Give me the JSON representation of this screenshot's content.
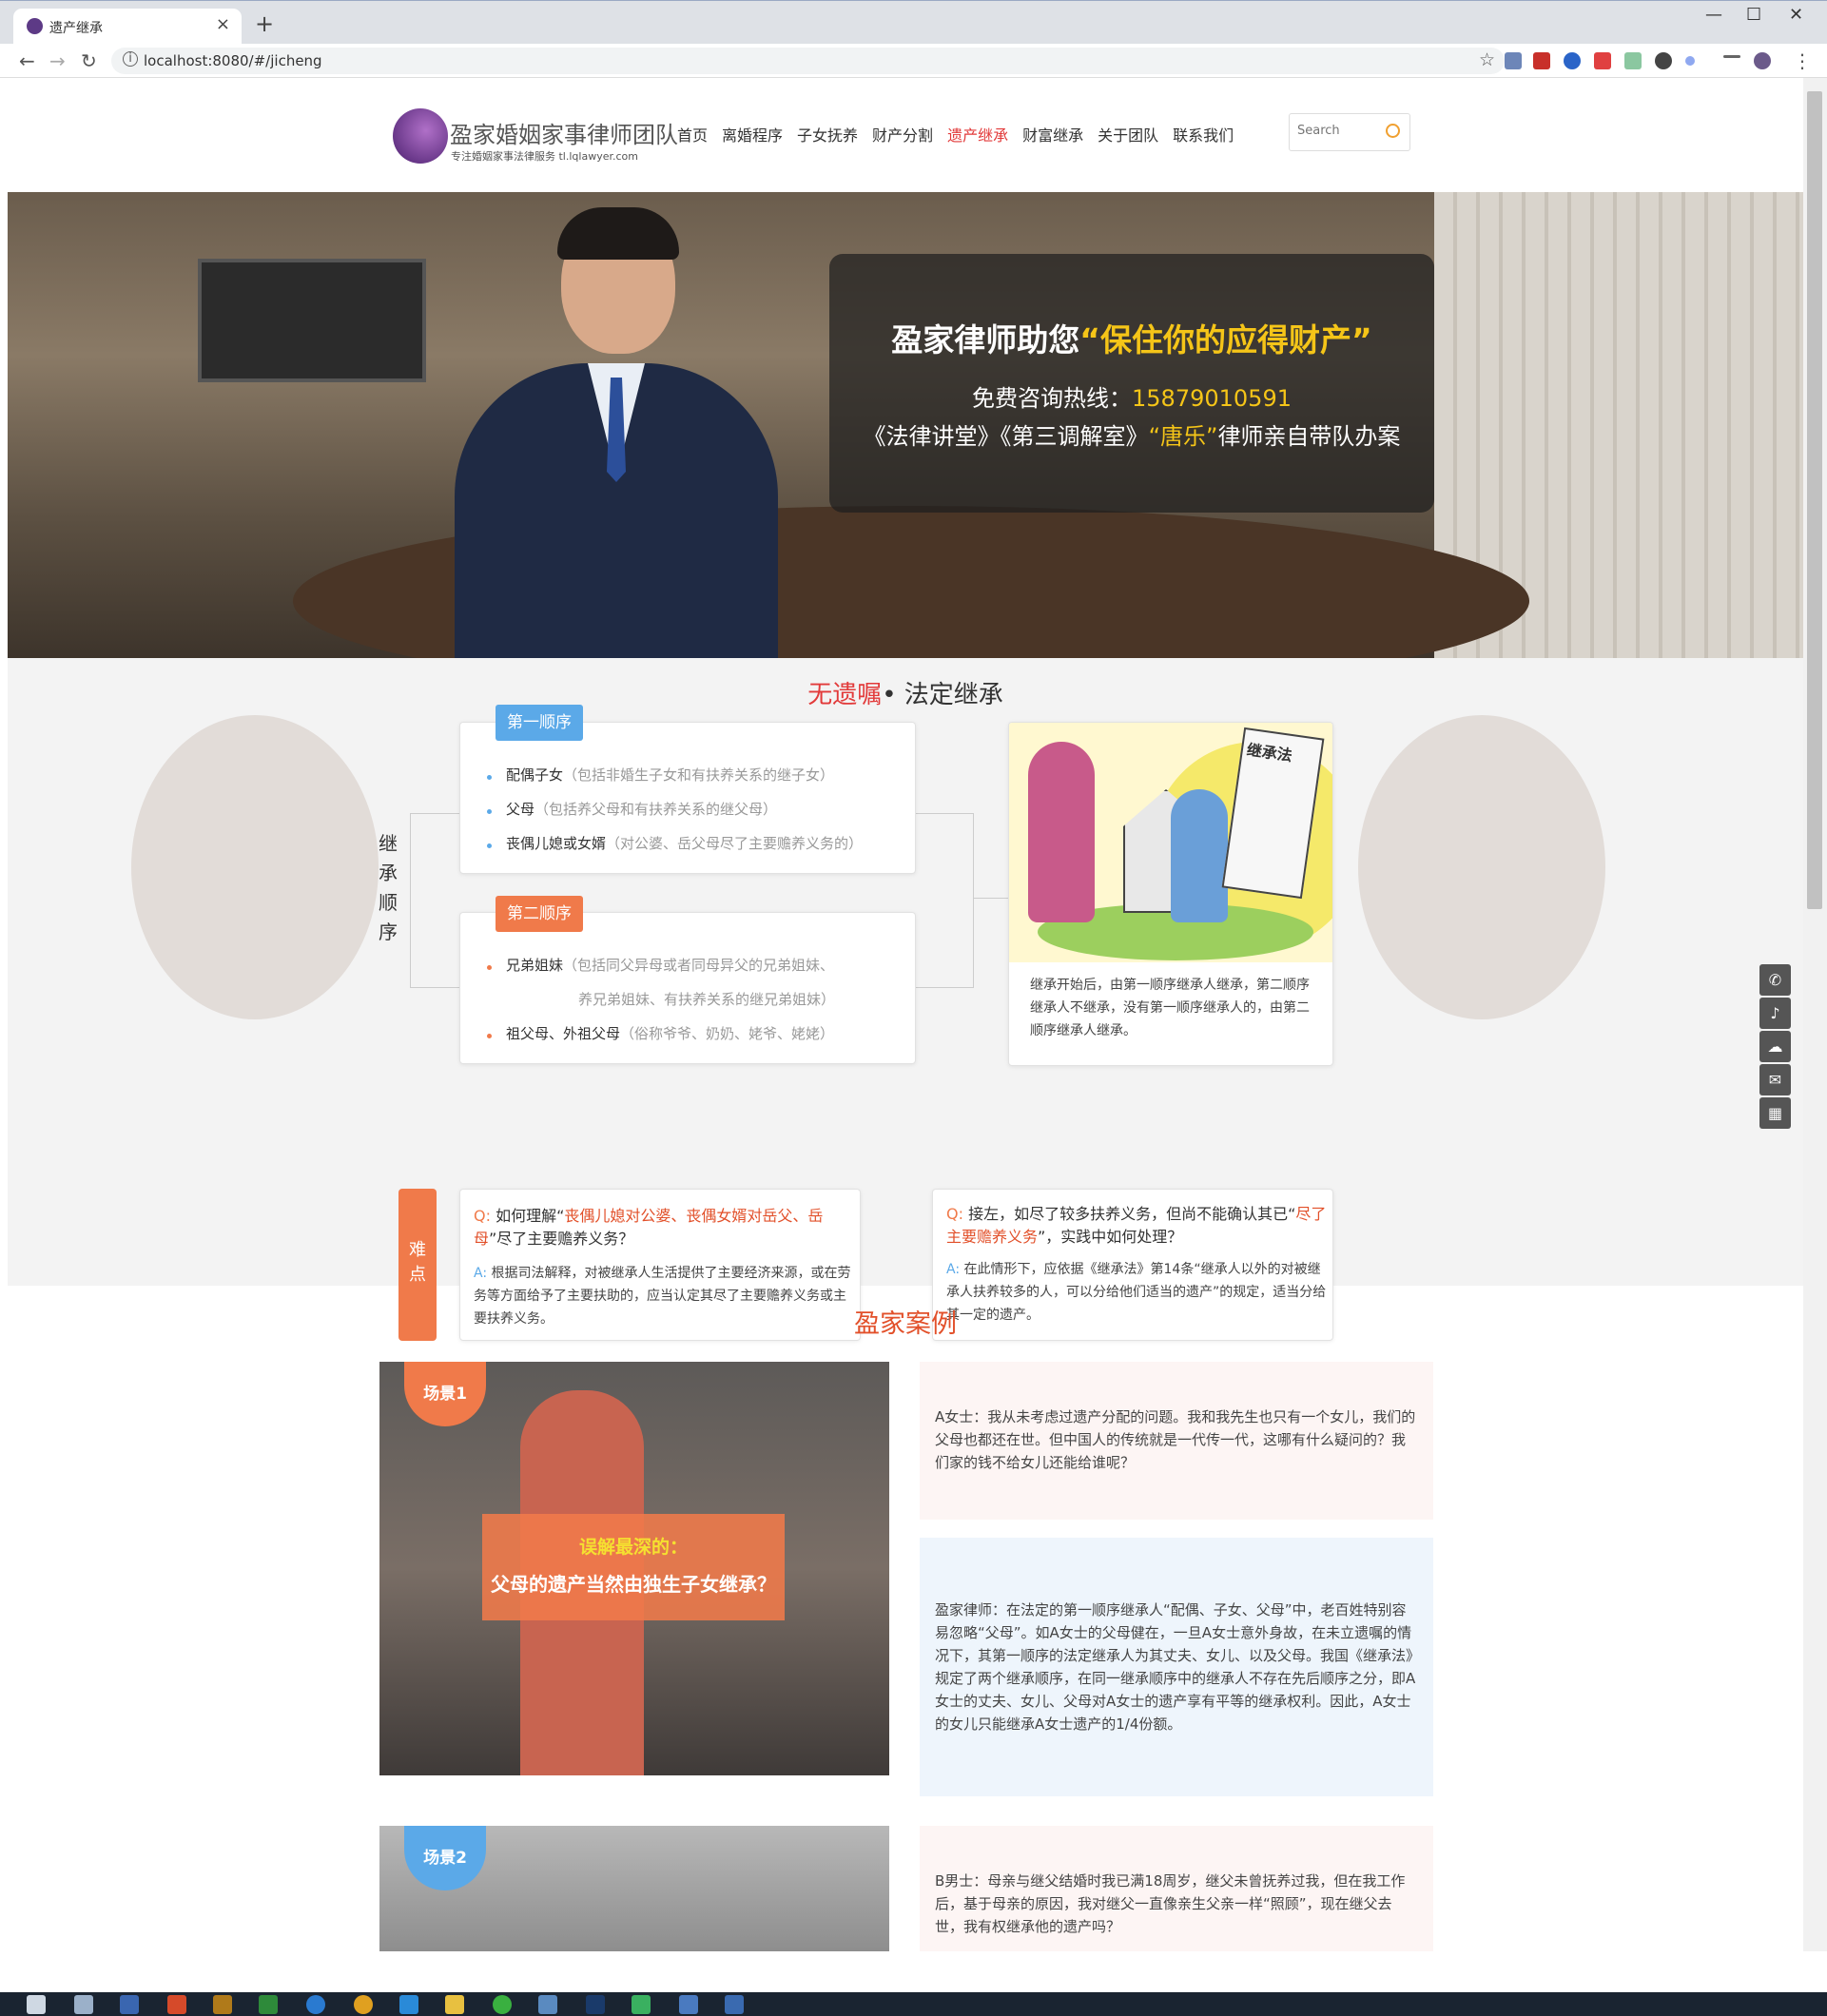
{
  "browser": {
    "tab_title": "遗产继承",
    "url": "localhost:8080/#/jicheng"
  },
  "header": {
    "logo_name": "盈家婚姻家事律师团队",
    "logo_sub": "专注婚姻家事法律服务 tl.lqlawyer.com",
    "nav": [
      "首页",
      "离婚程序",
      "子女抚养",
      "财产分割",
      "遗产继承",
      "财富继承",
      "关于团队",
      "联系我们"
    ],
    "active_nav": "遗产继承",
    "search_placeholder": "Search"
  },
  "banner": {
    "title_prefix": "盈家律师助您",
    "title_highlight": "“保住你的应得财产”",
    "hotline_label": "免费咨询热线：",
    "hotline_number": "15879010591",
    "line_prefix": "《法律讲堂》《第三调解室》",
    "line_highlight": "“唐乐”",
    "line_suffix": "律师亲自带队办案"
  },
  "section1": {
    "title_red": "无遗嘱",
    "title_rest": "• 法定继承",
    "vertical_label": "继承顺序",
    "first_order": {
      "tag": "第一顺序",
      "items": [
        {
          "main": "配偶子女",
          "note": "（包括非婚生子女和有扶养关系的继子女）"
        },
        {
          "main": "父母",
          "note": "（包括养父母和有扶养关系的继父母）"
        },
        {
          "main": "丧偶儿媳或女婿",
          "note": "（对公婆、岳父母尽了主要赡养义务的）"
        }
      ]
    },
    "second_order": {
      "tag": "第二顺序",
      "items": [
        {
          "main": "兄弟姐妹",
          "note": "（包括同父异母或者同母异父的兄弟姐妹、",
          "note2": "养兄弟姐妹、有扶养关系的继兄弟姐妹）"
        },
        {
          "main": "祖父母、外祖父母",
          "note": "（俗称爷爷、奶奶、姥爷、姥姥）"
        }
      ]
    },
    "illustration_text": "继承法",
    "illustration_desc": "继承开始后，由第一顺序继承人继承，第二顺序继承人不继承，没有第一顺序继承人的，由第二顺序继承人继承。",
    "difficulty_label": "难点",
    "qa1": {
      "q_mark": "Q:",
      "q_prefix": "如何理解“",
      "q_red": "丧偶儿媳对公婆、丧偶女婿对岳父、岳母",
      "q_suffix": "”尽了主要赡养义务？",
      "a_mark": "A:",
      "answer": "根据司法解释，对被继承人生活提供了主要经济来源，或在劳务等方面给予了主要扶助的，应当认定其尽了主要赡养义务或主要扶养义务。"
    },
    "qa2": {
      "q_mark": "Q:",
      "q_prefix": "接左，如尽了较多扶养义务，但尚不能确认其已“",
      "q_red": "尽了主要赡养义务",
      "q_suffix": "”，实践中如何处理？",
      "a_mark": "A:",
      "answer": "在此情形下，应依据《继承法》第14条“继承人以外的对被继承人扶养较多的人，可以分给他们适当的遗产”的规定，适当分给其一定的遗产。"
    }
  },
  "section2": {
    "title": "盈家案例",
    "scenes": [
      {
        "badge": "场景1",
        "callout_line1": "误解最深的：",
        "callout_line2": "父母的遗产当然由独生子女继承？",
        "question": "A女士：我从未考虑过遗产分配的问题。我和我先生也只有一个女儿，我们的父母也都还在世。但中国人的传统就是一代传一代，这哪有什么疑问的？我们家的钱不给女儿还能给谁呢？",
        "answer": "盈家律师：在法定的第一顺序继承人“配偶、子女、父母”中，老百姓特别容易忽略“父母”。如A女士的父母健在，一旦A女士意外身故，在未立遗嘱的情况下，其第一顺序的法定继承人为其丈夫、女儿、以及父母。我国《继承法》规定了两个继承顺序，在同一继承顺序中的继承人不存在先后顺序之分，即A女士的丈夫、女儿、父母对A女士的遗产享有平等的继承权利。因此，A女士的女儿只能继承A女士遗产的1/4份额。"
      },
      {
        "badge": "场景2",
        "question": "B男士：母亲与继父结婚时我已满18周岁，继父未曾抚养过我，但在我工作后，基于母亲的原因，我对继父一直像亲生父亲一样“照顾”，现在继父去世，我有权继承他的遗产吗？"
      }
    ]
  },
  "floats": [
    "phone-icon",
    "bell-icon",
    "chat-icon",
    "message-icon",
    "qrcode-icon"
  ],
  "colors": {
    "accent_red": "#e23a3a",
    "accent_orange": "#f07a4a",
    "accent_blue": "#5ba9e8",
    "highlight_yellow": "#f5c518"
  }
}
